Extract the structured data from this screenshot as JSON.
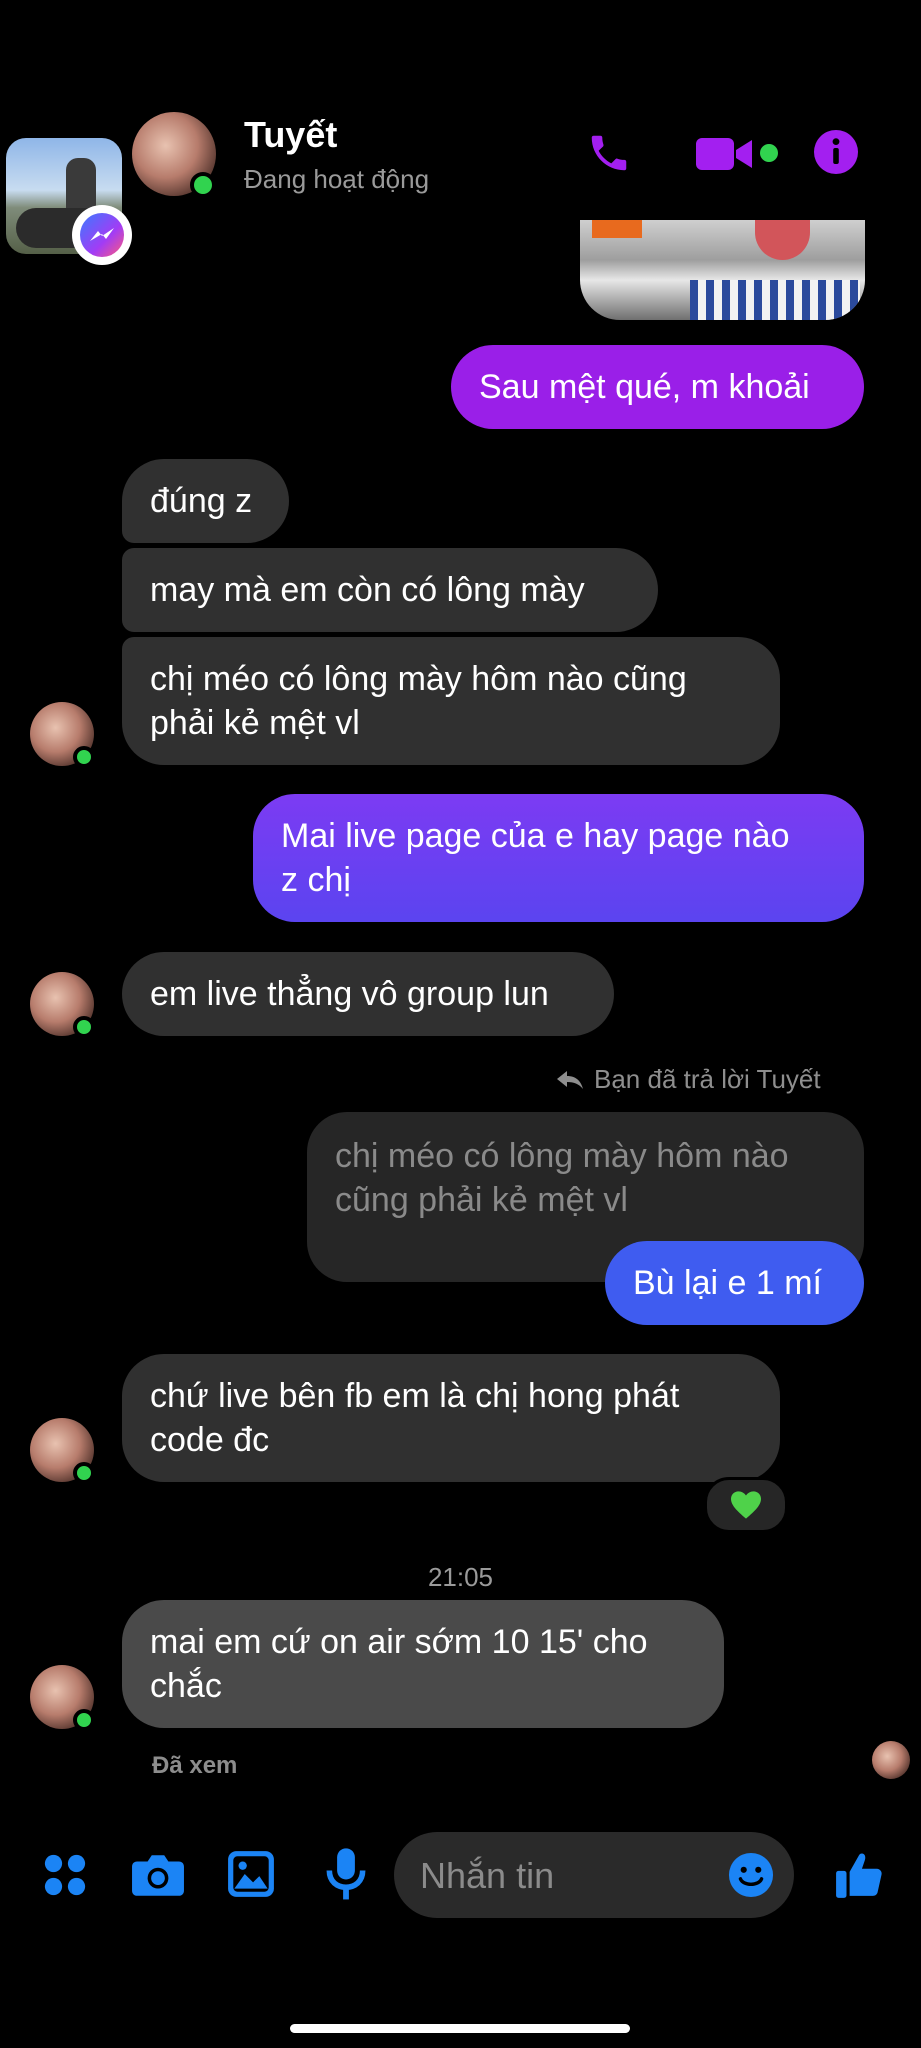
{
  "header": {
    "name": "Tuyết",
    "status": "Đang hoạt động"
  },
  "messages": [
    {
      "from": "me",
      "text": "Sau mệt qué, m khoải"
    },
    {
      "from": "them",
      "text": "đúng z"
    },
    {
      "from": "them",
      "text": "may mà em còn có lông mày"
    },
    {
      "from": "them",
      "text": "chị méo có lông mày hôm nào cũng\nphải kẻ mệt vl"
    },
    {
      "from": "me",
      "text": "Mai live page của e hay page nào\nz chị"
    },
    {
      "from": "them",
      "text": "em live thẳng vô group lun"
    },
    {
      "from": "me",
      "text": "Bù lại e 1 mí",
      "reply_note": "Bạn đã trả lời Tuyết",
      "quoted": "chị méo có lông mày hôm nào\ncũng phải kẻ mệt vl"
    },
    {
      "from": "them",
      "text": "chứ live bên fb em là chị hong phát\ncode đc",
      "reaction": "green-heart"
    },
    {
      "from": "them",
      "text": "mai em cứ on air sớm 10 15' cho\nchắc"
    }
  ],
  "timestamp": "21:05",
  "seen_label": "Đã xem",
  "composer": {
    "placeholder": "Nhắn tin"
  },
  "colors": {
    "accent": "#a31ff0",
    "composer_icons": "#1b84f5",
    "received_bubble": "#303030",
    "online": "#31d34f"
  },
  "icons": {
    "header": [
      "phone-icon",
      "video-camera-icon",
      "info-icon"
    ],
    "composer": [
      "apps-icon",
      "camera-icon",
      "gallery-icon",
      "microphone-icon",
      "emoji-icon",
      "like-thumb-icon"
    ]
  }
}
